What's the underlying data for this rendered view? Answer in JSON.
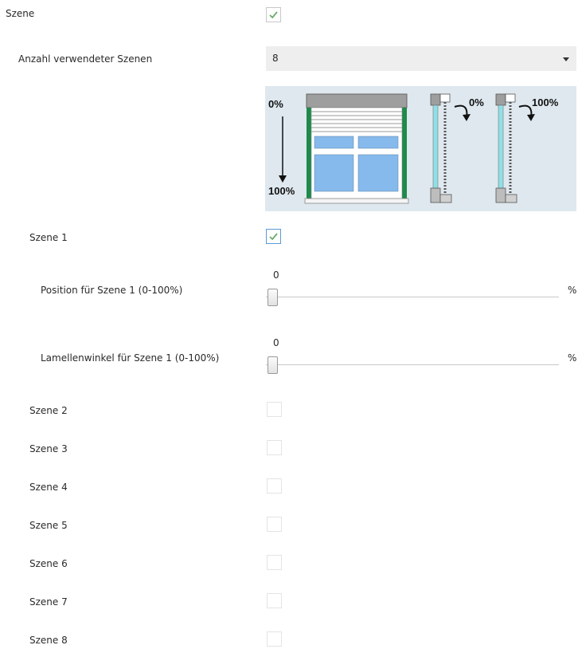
{
  "scene": {
    "label": "Szene",
    "checked": true
  },
  "scene_count": {
    "label": "Anzahl verwendeter Szenen",
    "value": "8"
  },
  "illustration": {
    "pos_start": "0%",
    "pos_end": "100%",
    "angle_0": "0%",
    "angle_100": "100%"
  },
  "scenes": [
    {
      "label": "Szene 1",
      "checked": true,
      "position_label": "Position für Szene 1 (0-100%)",
      "position_value": "0",
      "position_unit": "%",
      "angle_label": "Lamellenwinkel für Szene 1 (0-100%)",
      "angle_value": "0",
      "angle_unit": "%"
    },
    {
      "label": "Szene 2",
      "checked": false
    },
    {
      "label": "Szene 3",
      "checked": false
    },
    {
      "label": "Szene 4",
      "checked": false
    },
    {
      "label": "Szene 5",
      "checked": false
    },
    {
      "label": "Szene 6",
      "checked": false
    },
    {
      "label": "Szene 7",
      "checked": false
    },
    {
      "label": "Szene 8",
      "checked": false
    }
  ],
  "colors": {
    "check": "#6aab6a",
    "illustration_bg": "#dfe8ef",
    "window_frame_green": "#1e8a4c",
    "glass_blue": "#86b9ec"
  }
}
